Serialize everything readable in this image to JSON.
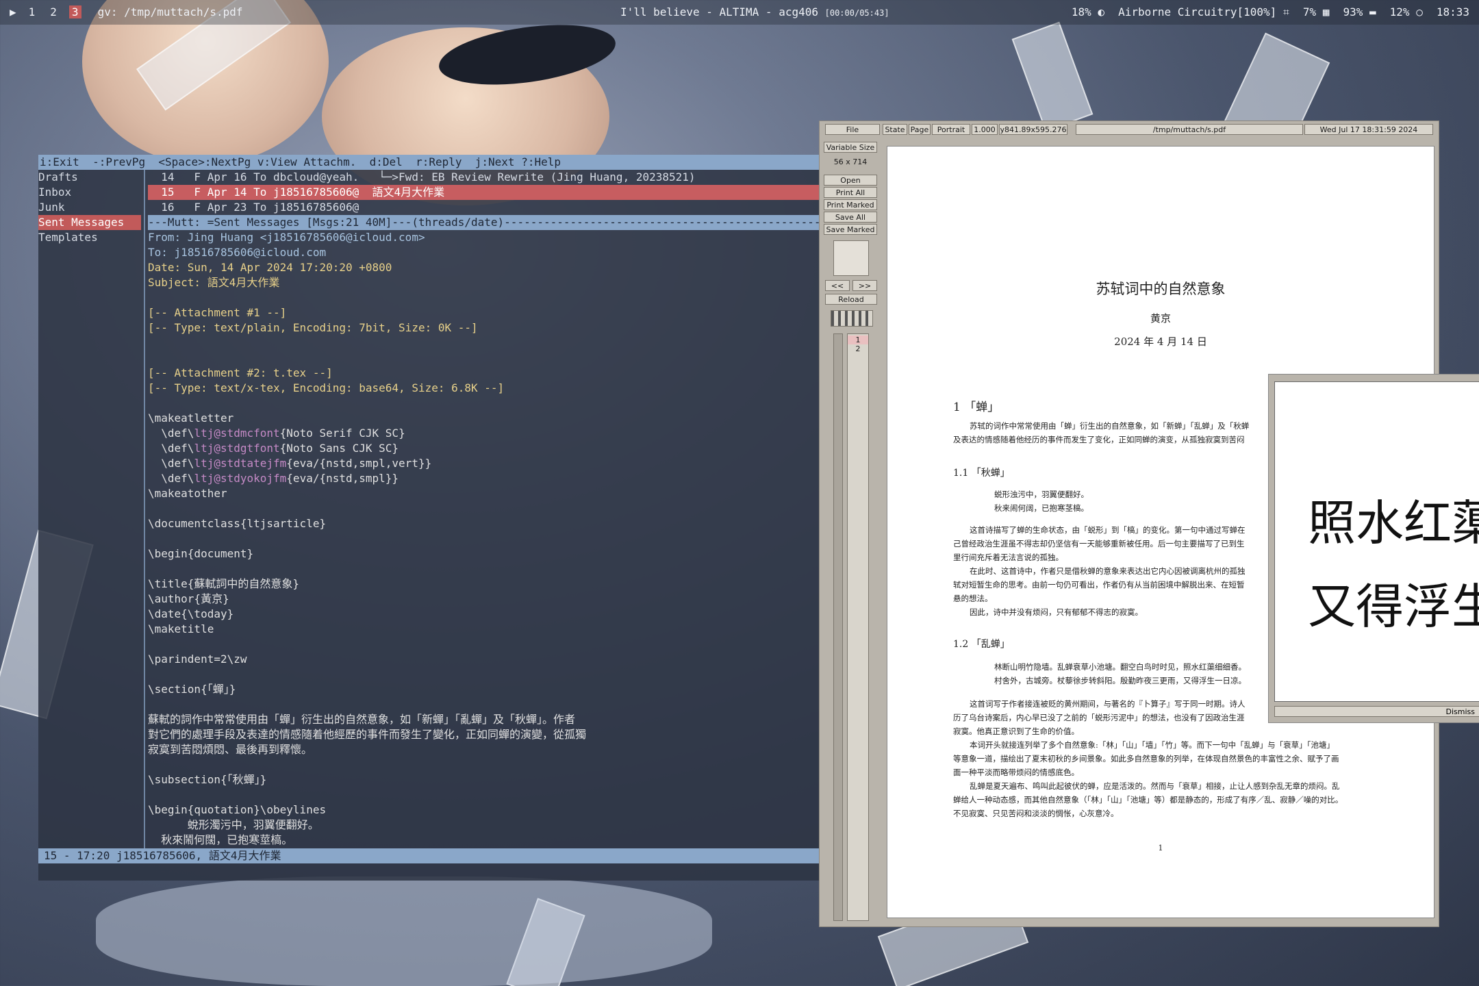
{
  "topbar": {
    "launcher_icon": "play-icon",
    "workspaces": [
      "1",
      "2",
      "3"
    ],
    "active_workspace": "3",
    "window_title": "gv: /tmp/muttach/s.pdf",
    "now_playing": "I'll believe - ALTIMA - acg406",
    "play_time": "[00:00/05:43]",
    "volume": "18%",
    "wifi": "Airborne Circuitry[100%]",
    "cpu": "7%",
    "battery": "93%",
    "mem": "12%",
    "clock": "18:33"
  },
  "mutt": {
    "help": "i:Exit  -:PrevPg  <Space>:NextPg v:View Attachm.  d:Del  r:Reply  j:Next ?:Help",
    "sidebar": [
      "Drafts",
      "Inbox",
      "Junk",
      "Sent Messages",
      "Templates"
    ],
    "sidebar_active": "Sent Messages",
    "index": [
      "  14   F Apr 16 To dbcloud@yeah.   └─>Fwd: EB Review Rewrite (Jing Huang, 20238521)",
      "  15   F Apr 14 To j18516785606@  語文4月大作業",
      "  16   F Apr 23 To j18516785606@"
    ],
    "status": "---Mutt: =Sent Messages [Msgs:21 40M]---(threads/date)----------------------------------------------------",
    "headers": {
      "from": "From: Jing Huang <j18516785606@icloud.com>",
      "to": "To: j18516785606@icloud.com",
      "date": "Date: Sun, 14 Apr 2024 17:20:20 +0800",
      "subject": "Subject: 語文4月大作業"
    },
    "att1a": "[-- Attachment #1 --]",
    "att1b": "[-- Type: text/plain, Encoding: 7bit, Size: 0K --]",
    "att2a": "[-- Attachment #2: t.tex --]",
    "att2b": "[-- Type: text/x-tex, Encoding: base64, Size: 6.8K --]",
    "body": {
      "l1": "\\makeatletter",
      "l2a": "  \\def\\",
      "l2b": "ltj@stdmcfont",
      "l2c": "{Noto Serif CJK SC}",
      "l3a": "  \\def\\",
      "l3b": "ltj@stdgtfont",
      "l3c": "{Noto Sans CJK SC}",
      "l4a": "  \\def\\",
      "l4b": "ltj@stdtatejfm",
      "l4c": "{eva/{nstd,smpl,vert}}",
      "l5a": "  \\def\\",
      "l5b": "ltj@stdyokojfm",
      "l5c": "{eva/{nstd,smpl}}",
      "l6": "\\makeatother",
      "l7": "\\documentclass{ltjsarticle}",
      "l8": "\\begin{document}",
      "l9": "\\title{蘇軾詞中的自然意象}",
      "l10": "\\author{黃京}",
      "l11": "\\date{\\today}",
      "l12": "\\maketitle",
      "l13": "\\parindent=2\\zw",
      "l14": "\\section{「蟬」}",
      "l15": "蘇軾的詞作中常常使用由「蟬」衍生出的自然意象，如「新蟬」「亂蟬」及「秋蟬」。作者",
      "l16": "對它們的處理手段及表達的情感隨着他經歷的事件而發生了變化，正如同蟬的演變，從孤獨",
      "l17": "寂寞到苦悶煩悶、最後再到釋懷。",
      "l18": "\\subsection{「秋蟬」}",
      "l19": "\\begin{quotation}\\obeylines",
      "l20": "      蛻形濁污中，羽翼便翻好。",
      "l21": "  秋來鬧何闊，已抱寒莖槁。"
    },
    "bottom": "15 - 17:20 j18516785606, 語文4月大作業"
  },
  "gv": {
    "menu": {
      "file": "File",
      "state": "State",
      "page": "Page",
      "orientation": "Portrait",
      "scale": "1.000",
      "media": "y841.89x595.276",
      "path": "/tmp/muttach/s.pdf",
      "date": "Wed Jul 17 18:31:59 2024"
    },
    "size_mode": "Variable Size",
    "dims": "56 x 714",
    "buttons": [
      "Open",
      "Print All",
      "Print Marked",
      "Save All",
      "Save Marked"
    ],
    "prev": "<<",
    "next": ">>",
    "reload": "Reload",
    "pages": [
      "1",
      "2"
    ],
    "doc": {
      "title": "苏轼词中的自然意象",
      "author": "黄京",
      "date": "2024 年 4 月 14 日",
      "s1": "1   「蝉」",
      "p1a": "苏轼的词作中常常使用由「蝉」衍生出的自然意象，如「新蝉」「乱蝉」及「秋蝉",
      "p1b": "及表达的情感随着他经历的事件而发生了变化，正如同蝉的演变，从孤独寂寞到苦闷",
      "s11": "1.1   「秋蝉」",
      "q1a": "蜕形浊污中，羽翼便翻好。",
      "q1b": "秋来闹何阔，已抱寒茎槁。",
      "p2a": "这首诗描写了蝉的生命状态，由「蜕形」到「槁」的变化。第一句中通过写蝉在",
      "p2b": "己曾经政治生涯虽不得志却仍坚信有一天能够重新被任用。后一句主要描写了已到生",
      "p2c": "里行间充斥着无法言说的孤独。",
      "p3a": "在此时、这首诗中，作者只是借秋蝉的意象来表达出它内心因被调离杭州的孤独",
      "p3b": "轼对短暂生命的思考。由前一句仍可看出，作者仍有从当前困境中解脱出来、在短暂",
      "p3c": "悬的想法。",
      "p3d": "因此，诗中并没有烦闷，只有郁郁不得志的寂寞。",
      "s12": "1.2   「乱蝉」",
      "q2a": "林断山明竹隐墙。乱蝉衰草小池塘。翻空白鸟时时见，照水红蕖细细香。",
      "q2b": "村舍外，古城旁。杖藜徐步转斜阳。殷勤昨夜三更雨，又得浮生一日凉。",
      "p4a": "这首词写于作者接连被贬的黄州期间，与著名的『卜算子』写于同一时期。诗人",
      "p4b": "历了乌台诗案后，内心早已没了之前的「蜕形污泥中」的想法，也没有了因政治生涯",
      "p4c": "寂寞。他真正意识到了生命的价值。",
      "p5a": "本词开头就接连列举了多个自然意象:「林」「山」「墙」「竹」等。而下一句中「乱蝉」与「衰草」「池塘」",
      "p5b": "等意象一道，描绘出了夏末初秋的乡间景象。如此多自然意象的列举，在体现自然景色的丰富性之余、赋予了画",
      "p5c": "面一种平淡而略带烦闷的情感底色。",
      "p6a": "乱蝉是夏天遍布、鸣叫此起彼伏的蝉，应是活泼的。然而与「衰草」相接，止让人感到杂乱无章的烦闷。乱",
      "p6b": "蝉给人一种动态感，而其他自然意象（「林」「山」「池塘」等）都是静态的，形成了有序／乱、寂静／噪的对比。",
      "p6c": "不见寂寞、只见苦闷和淡淡的惆怅，心灰意冷。",
      "pageno": "1"
    },
    "popup": {
      "line1": "照水红蕖",
      "line2": "又得浮生",
      "dismiss": "Dismiss"
    }
  }
}
